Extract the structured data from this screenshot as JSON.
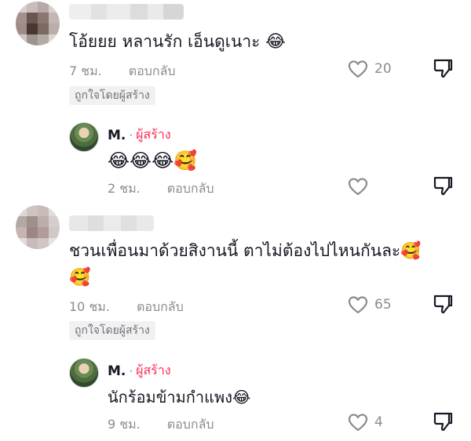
{
  "comments": [
    {
      "text": "โอ้ยยย หลานรัก เอ็นดูเนาะ",
      "emoji": "😂",
      "time": "7 ชม.",
      "reply_label": "ตอบกลับ",
      "likes": "20",
      "liked_by_creator": "ถูกใจโดยผู้สร้าง",
      "reply": {
        "author": "M.",
        "dot": "·",
        "badge": "ผู้สร้าง",
        "emoji": "😂😂😂🥰",
        "time": "2 ชม.",
        "reply_label": "ตอบกลับ"
      }
    },
    {
      "text": "ชวนเพื่อนมาด้วยสิงานนี้ ตาไม่ต้องไปไหนกันละ🥰",
      "text_line2": "🥰",
      "time": "10 ชม.",
      "reply_label": "ตอบกลับ",
      "likes": "65",
      "liked_by_creator": "ถูกใจโดยผู้สร้าง",
      "reply": {
        "author": "M.",
        "dot": "·",
        "badge": "ผู้สร้าง",
        "text": "นักร้อมข้ามกำแพง😂",
        "time": "9 ชม.",
        "reply_label": "ตอบกลับ",
        "likes": "4"
      }
    }
  ],
  "icons": {
    "like": "heart-outline-icon",
    "dislike": "thumbs-down-outline-icon"
  },
  "colors": {
    "creator_badge": "#fe2c55",
    "meta_text": "#8a8b91",
    "badge_bg": "#f1f1f2"
  }
}
